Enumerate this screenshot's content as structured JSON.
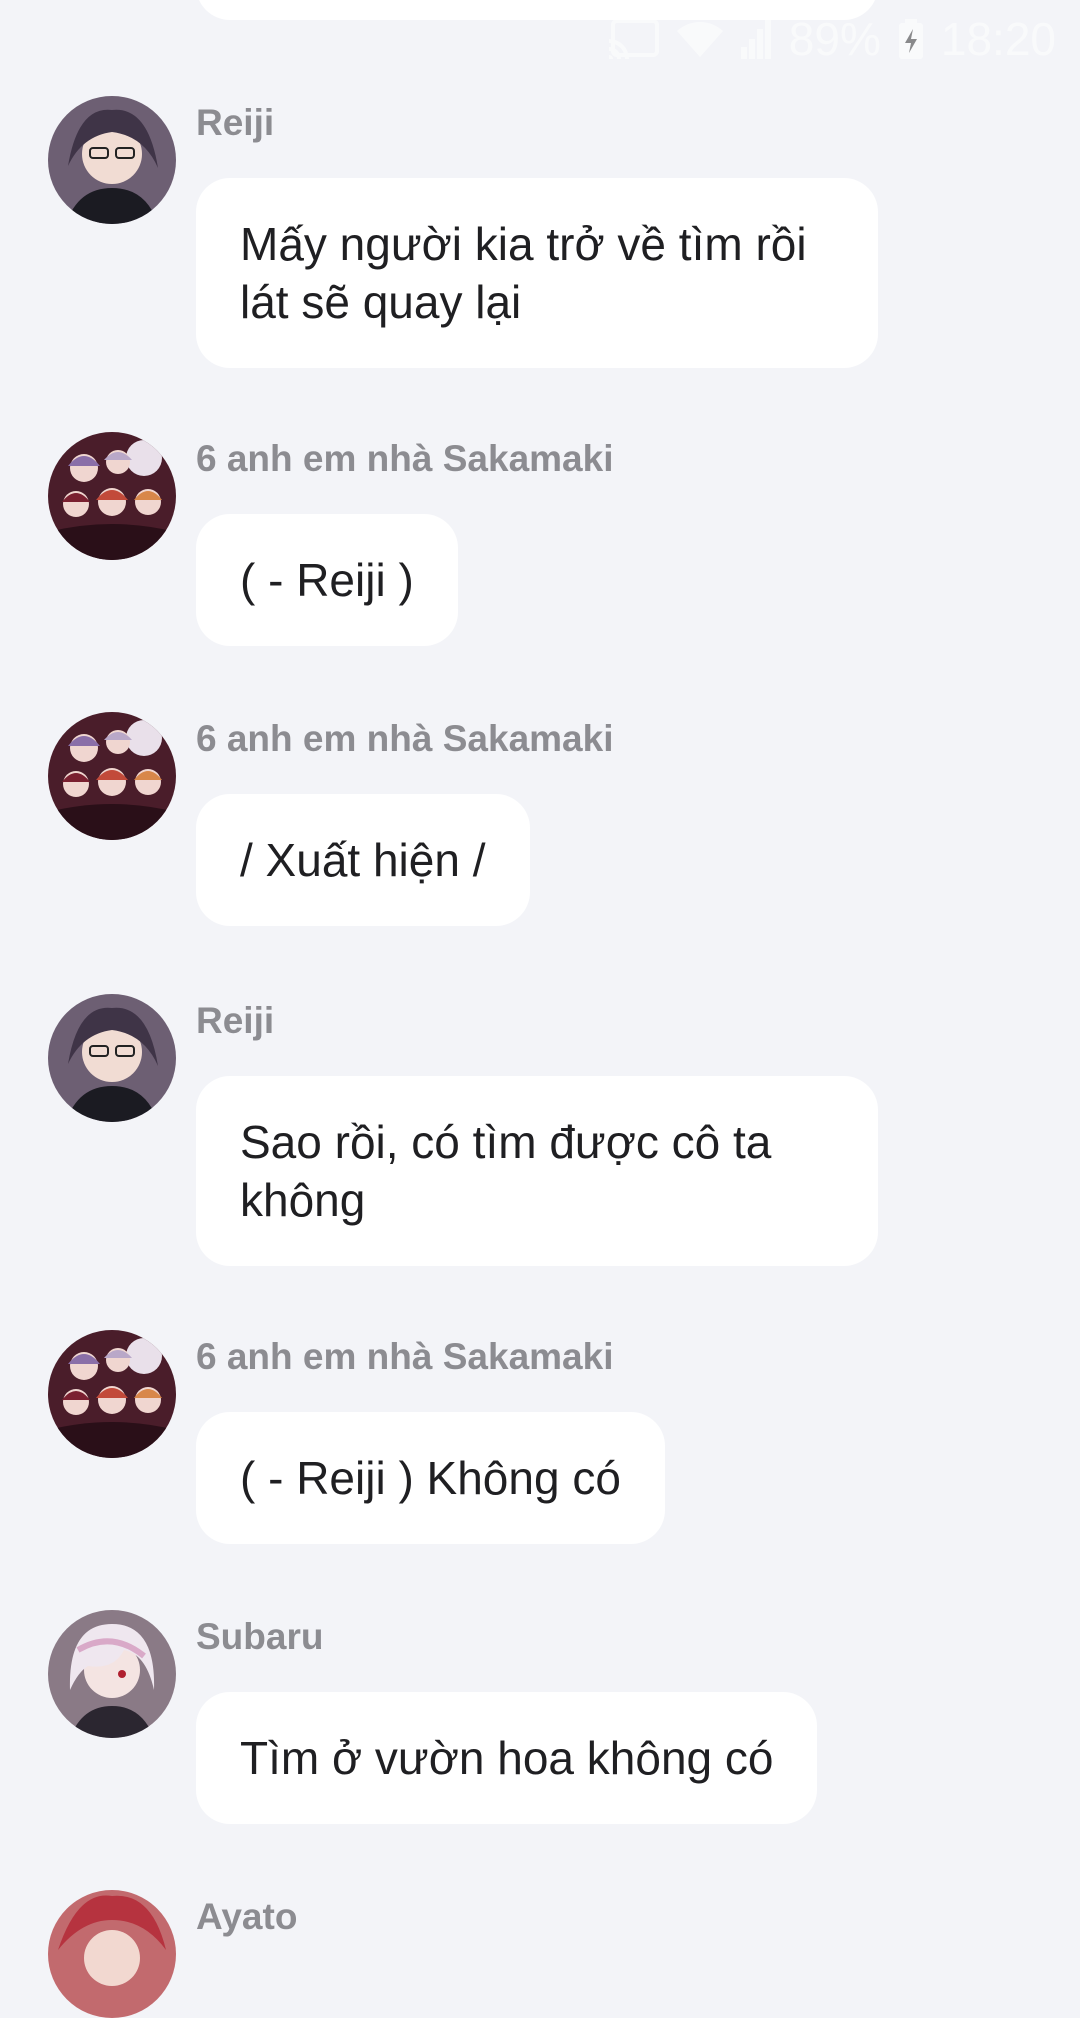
{
  "status_bar": {
    "battery": "89%",
    "time": "18:20",
    "icons": [
      "cast-icon",
      "wifi-icon",
      "signal-icon",
      "battery-charging-icon"
    ]
  },
  "messages": [
    {
      "sender": "Reiji",
      "avatar": "reiji-avatar",
      "text": "Mấy người kia trở về tìm rồi lát sẽ quay lại"
    },
    {
      "sender": "6 anh em nhà Sakamaki",
      "avatar": "sakamaki-group-avatar",
      "text": "( - Reiji )"
    },
    {
      "sender": "6 anh em nhà Sakamaki",
      "avatar": "sakamaki-group-avatar",
      "text": "/ Xuất hiện /"
    },
    {
      "sender": "Reiji",
      "avatar": "reiji-avatar",
      "text": "Sao rồi, có tìm được cô ta không"
    },
    {
      "sender": "6 anh em nhà Sakamaki",
      "avatar": "sakamaki-group-avatar",
      "text": "( - Reiji ) Không có"
    },
    {
      "sender": "Subaru",
      "avatar": "subaru-avatar",
      "text": "Tìm ở vườn hoa không có"
    },
    {
      "sender": "Ayato",
      "avatar": "ayato-avatar",
      "text": ""
    }
  ],
  "colors": {
    "background": "#f3f4f8",
    "bubble": "#ffffff",
    "sender_text": "#8c8c91",
    "message_text": "#1f1f22"
  }
}
